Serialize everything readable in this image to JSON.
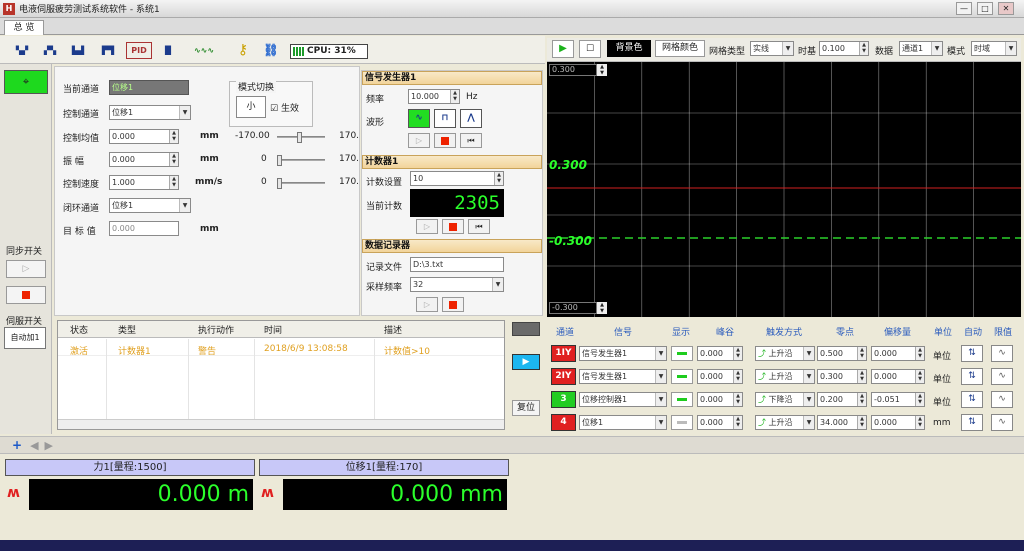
{
  "window": {
    "title": "电液伺服疲劳测试系统软件 - 系统1",
    "app_icon": "H"
  },
  "tabs": [
    {
      "label": "总 览"
    }
  ],
  "toolbar": {
    "cpu_label": "CPU: 31%"
  },
  "left_strip": {
    "sync_switch_label": "同步开关",
    "servo_switch_label": "伺服开关",
    "auto_label": "自动加1"
  },
  "control": {
    "current_channel_label": "当前通道",
    "current_channel_value": "位移1",
    "control_channel_label": "控制通道",
    "control_channel_value": "位移1",
    "mode_switch_label": "模式切换",
    "control_mean_label": "控制均值",
    "control_mean_value": "0.000",
    "amplitude_label": "振    幅",
    "amplitude_value": "0.000",
    "speed_label": "控制速度",
    "speed_value": "1.000",
    "closed_loop_label": "闭环通道",
    "closed_loop_value": "位移1",
    "target_label": "目 标 值",
    "target_value": "0.000",
    "unit_mm": "mm",
    "unit_mms": "mm/s",
    "mean_min": "-170.00",
    "mean_max": "170.",
    "amp_min": "0",
    "amp_max": "170.",
    "speed_min": "0",
    "speed_max": "170.",
    "effective_label": "生效",
    "mode_icon": "小"
  },
  "signal_gen": {
    "title": "信号发生器1",
    "freq_label": "频率",
    "freq_value": "10.000",
    "freq_unit": "Hz",
    "wave_label": "波形"
  },
  "counter": {
    "title": "计数器1",
    "set_label": "计数设置",
    "set_value": "10",
    "current_label": "当前计数",
    "current_value": "2305"
  },
  "recorder": {
    "title": "数据记录器",
    "file_label": "记录文件",
    "file_value": "D:\\3.txt",
    "rate_label": "采样频率",
    "rate_value": "32"
  },
  "chart_bar": {
    "bg_color_label": "背景色",
    "grid_color_label": "网格颜色",
    "grid_type_label": "网格类型",
    "grid_type_value": "实线",
    "time_label": "时基",
    "time_value": "0.100",
    "source_label": "数据",
    "source_value": "通道1",
    "mode_label": "模式",
    "mode_value": "时域"
  },
  "chart_data": {
    "type": "line",
    "ytop_label": "0.300",
    "ybottom_label": "-0.300",
    "mark_upper": "0.300",
    "mark_lower": "-0.300",
    "background": "#000000",
    "grid": true,
    "series_colors": [
      "#e02020",
      "#2bff2b"
    ]
  },
  "events_table": {
    "columns": [
      "状态",
      "类型",
      "执行动作",
      "时间",
      "描述"
    ],
    "rows": [
      [
        "激活",
        "计数器1",
        "警告",
        "2018/6/9 13:08:58",
        "计数值>10"
      ]
    ],
    "reset_label": "复位"
  },
  "channels": {
    "headers": [
      "通道",
      "信号",
      "显示",
      "峰谷",
      "触发方式",
      "零点",
      "偏移量",
      "单位",
      "自动",
      "限值"
    ],
    "rows": [
      {
        "badge": "1IY",
        "badge_color": "#e02020",
        "signal": "信号发生器1",
        "value": "0.000",
        "trigger": "上升沿",
        "zero": "0.500",
        "offset": "0.000",
        "unit": "单位"
      },
      {
        "badge": "2IY",
        "badge_color": "#e02020",
        "signal": "信号发生器1",
        "value": "0.000",
        "trigger": "上升沿",
        "zero": "0.300",
        "offset": "0.000",
        "unit": "单位"
      },
      {
        "badge": "3",
        "badge_color": "#22cc22",
        "signal": "位移控制器1",
        "value": "0.000",
        "trigger": "下降沿",
        "zero": "0.200",
        "offset": "-0.051",
        "unit": "单位"
      },
      {
        "badge": "4",
        "badge_color": "#e02020",
        "signal": "位移1",
        "value": "0.000",
        "trigger": "上升沿",
        "zero": "34.000",
        "offset": "0.000",
        "unit": "mm"
      }
    ]
  },
  "meters": [
    {
      "header": "力1[量程:1500]",
      "value": "0.000 m"
    },
    {
      "header": "位移1[量程:170]",
      "value": "0.000 mm"
    }
  ]
}
